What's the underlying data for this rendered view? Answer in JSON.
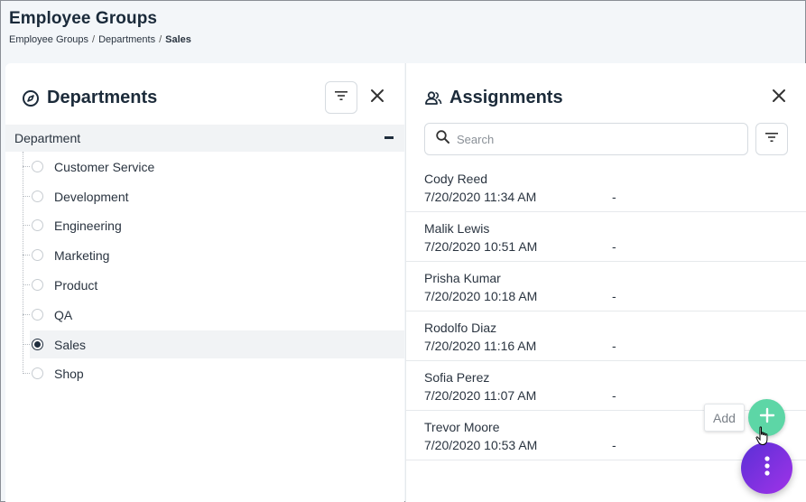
{
  "page": {
    "title": "Employee Groups",
    "breadcrumb": [
      "Employee Groups",
      "Departments",
      "Sales"
    ],
    "breadcrumb_separator": "/"
  },
  "departments_panel": {
    "title": "Departments",
    "title_icon": "compass-icon",
    "filter_icon": "filter-icon",
    "close_icon": "close-icon",
    "tree_root": "Department",
    "tree_root_state": "expanded",
    "items": [
      {
        "label": "Customer Service",
        "selected": false
      },
      {
        "label": "Development",
        "selected": false
      },
      {
        "label": "Engineering",
        "selected": false
      },
      {
        "label": "Marketing",
        "selected": false
      },
      {
        "label": "Product",
        "selected": false
      },
      {
        "label": "QA",
        "selected": false
      },
      {
        "label": "Sales",
        "selected": true
      },
      {
        "label": "Shop",
        "selected": false
      }
    ]
  },
  "assignments_panel": {
    "title": "Assignments",
    "title_icon": "users-icon",
    "close_icon": "close-icon",
    "search_placeholder": "Search",
    "search_value": "",
    "filter_icon": "filter-icon",
    "rows": [
      {
        "name": "Cody Reed",
        "timestamp": "7/20/2020 11:34 AM",
        "end": "-"
      },
      {
        "name": "Malik Lewis",
        "timestamp": "7/20/2020 10:51 AM",
        "end": "-"
      },
      {
        "name": "Prisha Kumar",
        "timestamp": "7/20/2020 10:18 AM",
        "end": "-"
      },
      {
        "name": "Rodolfo Diaz",
        "timestamp": "7/20/2020 11:16 AM",
        "end": "-"
      },
      {
        "name": "Sofia Perez",
        "timestamp": "7/20/2020 11:07 AM",
        "end": "-"
      },
      {
        "name": "Trevor Moore",
        "timestamp": "7/20/2020 10:53 AM",
        "end": "-"
      }
    ]
  },
  "fab": {
    "add_tooltip": "Add",
    "add_icon": "plus-icon",
    "add_color": "#5dd6a6",
    "menu_icon": "more-vertical-icon",
    "menu_gradient": [
      "#5a2fd6",
      "#a033e8"
    ]
  }
}
